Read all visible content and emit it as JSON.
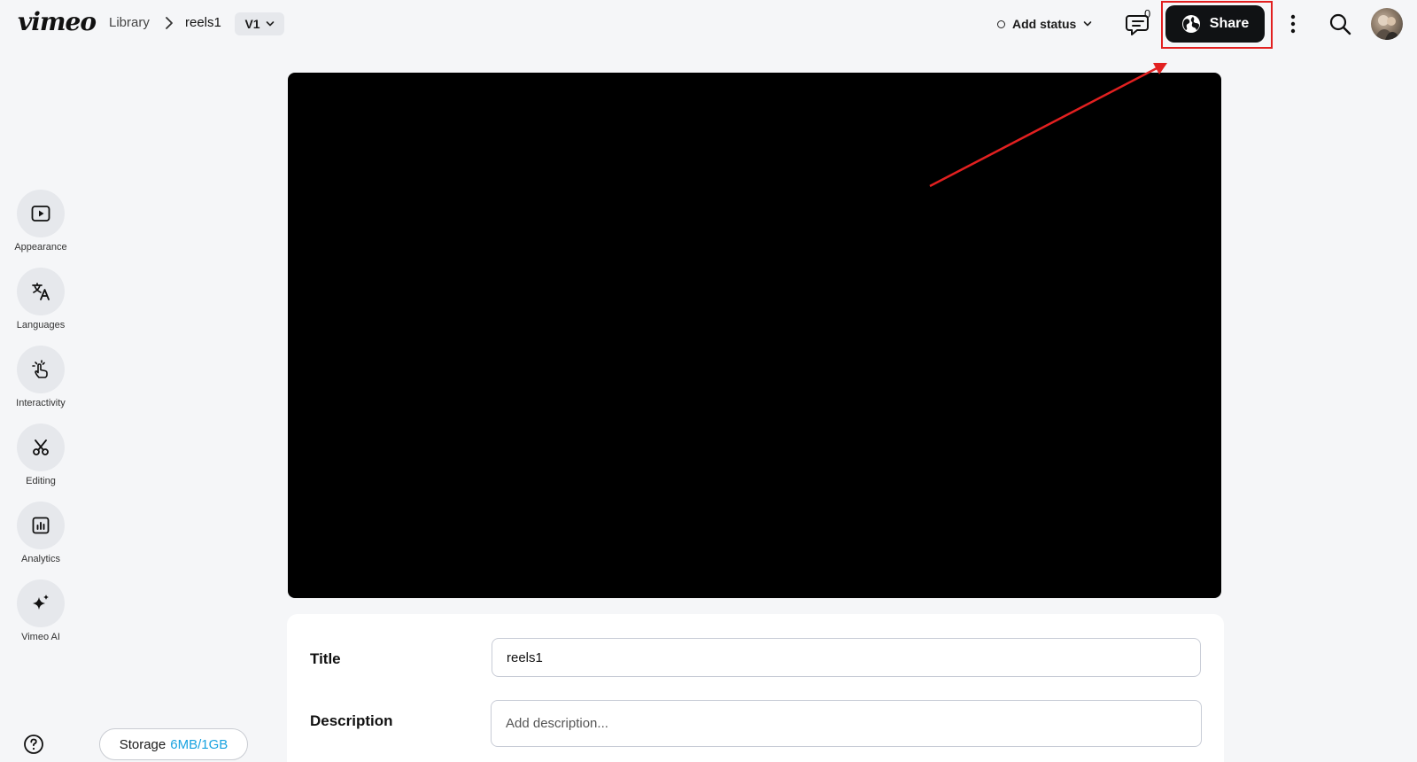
{
  "app": {
    "logo": "vimeo"
  },
  "breadcrumb": {
    "library": "Library",
    "current": "reels1"
  },
  "version": {
    "label": "V1"
  },
  "status": {
    "label": "Add status"
  },
  "comments": {
    "count": "0"
  },
  "share": {
    "label": "Share"
  },
  "sidebar": {
    "items": [
      {
        "label": "Appearance",
        "icon": "play-square-icon"
      },
      {
        "label": "Languages",
        "icon": "translate-icon"
      },
      {
        "label": "Interactivity",
        "icon": "tap-pointer-icon"
      },
      {
        "label": "Editing",
        "icon": "scissors-icon"
      },
      {
        "label": "Analytics",
        "icon": "bar-chart-icon"
      },
      {
        "label": "Vimeo AI",
        "icon": "sparkle-icon"
      }
    ]
  },
  "storage": {
    "label": "Storage",
    "value": "6MB/1GB"
  },
  "details": {
    "title_label": "Title",
    "title_value": "reels1",
    "description_label": "Description",
    "description_placeholder": "Add description..."
  },
  "annotation": {
    "color": "#e22020"
  },
  "colors": {
    "accent_storage": "#17a2e0",
    "share_bg": "#101214"
  }
}
